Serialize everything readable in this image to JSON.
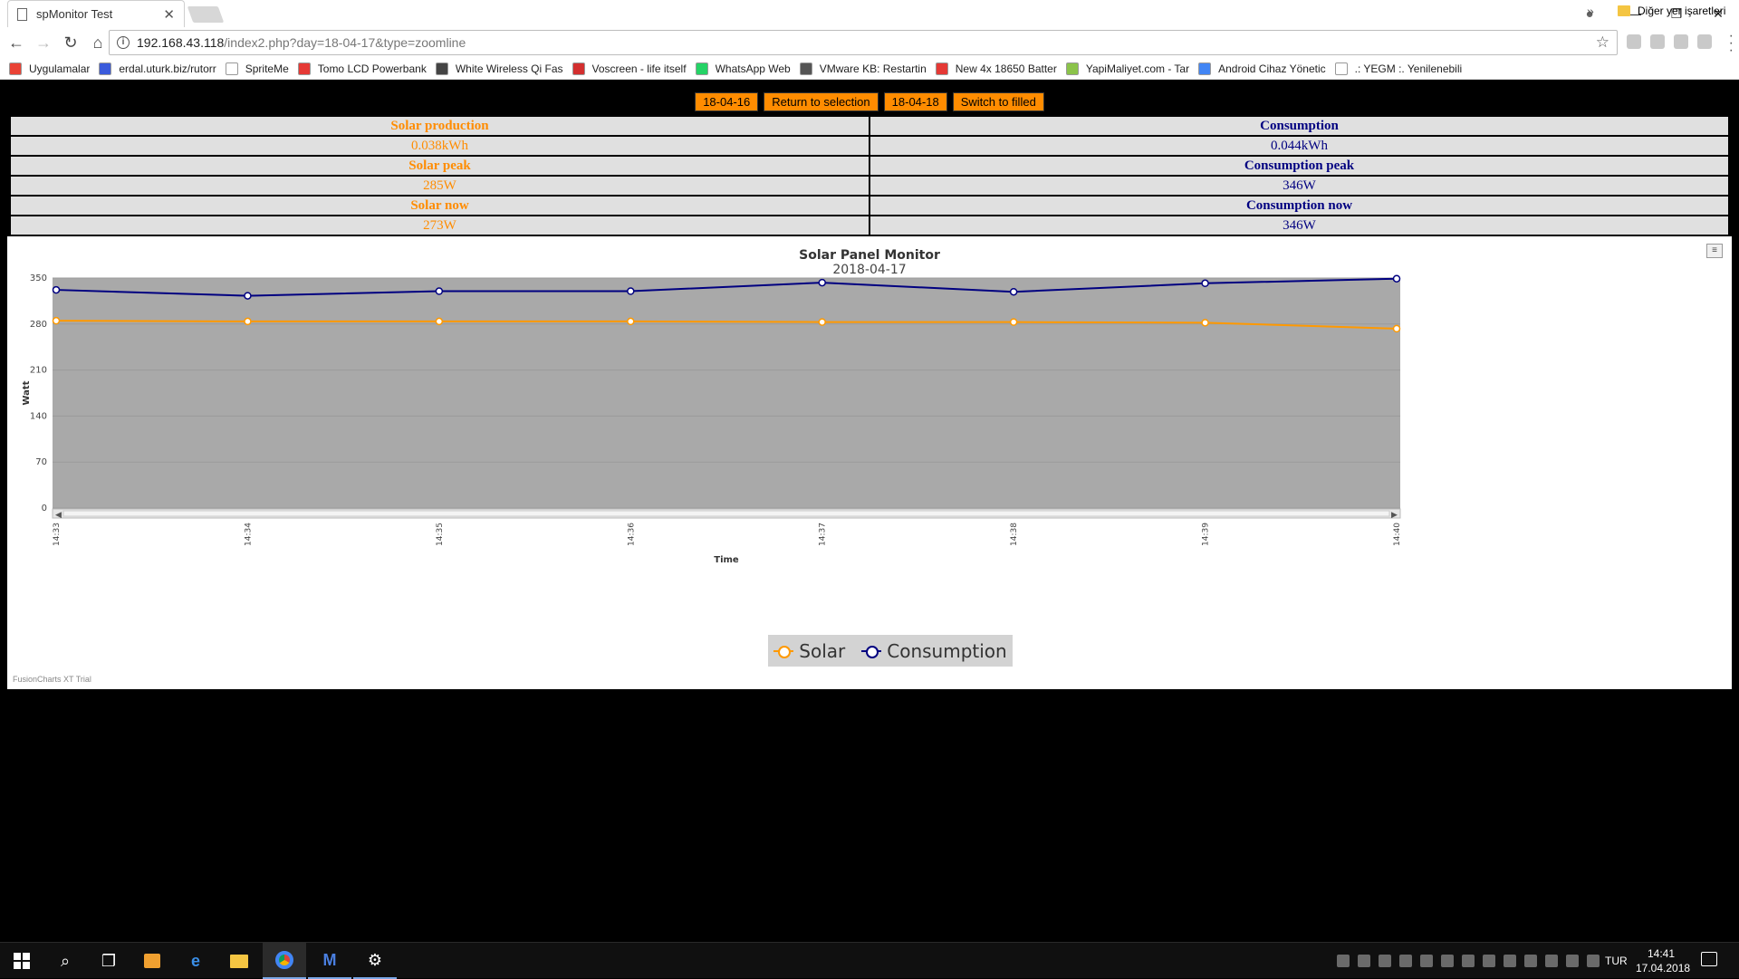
{
  "browser": {
    "tab_title": "spMonitor Test",
    "address_host": "192.168.43.118",
    "address_path": "/index2.php?day=18-04-17&type=zoomline",
    "bookmarks": [
      {
        "label": "Uygulamalar",
        "color": "#e94235"
      },
      {
        "label": "erdal.uturk.biz/rutorr",
        "color": "#3b5bdb"
      },
      {
        "label": "SpriteMe",
        "color": "#ffffff"
      },
      {
        "label": "Tomo LCD Powerbank",
        "color": "#e53935"
      },
      {
        "label": "White Wireless Qi Fas",
        "color": "#444444"
      },
      {
        "label": "Voscreen - life itself",
        "color": "#d32f2f"
      },
      {
        "label": "WhatsApp Web",
        "color": "#25d366"
      },
      {
        "label": "VMware KB: Restartin",
        "color": "#555555"
      },
      {
        "label": "New 4x 18650 Batter",
        "color": "#e53935"
      },
      {
        "label": "YapiMaliyet.com - Tar",
        "color": "#8bc34a"
      },
      {
        "label": "Android Cihaz Yönetic",
        "color": "#4285f4"
      },
      {
        "label": ".: YEGM :. Yenilenebili",
        "color": "#ffffff"
      }
    ],
    "other_bookmarks": "Diğer yer işaretleri"
  },
  "nav": {
    "prev_day": "18-04-16",
    "return": "Return to selection",
    "next_day": "18-04-18",
    "switch": "Switch to filled"
  },
  "stats": {
    "solar_production_label": "Solar production",
    "solar_production_value": "0.038kWh",
    "solar_peak_label": "Solar peak",
    "solar_peak_value": "285W",
    "solar_now_label": "Solar now",
    "solar_now_value": "273W",
    "consumption_label": "Consumption",
    "consumption_value": "0.044kWh",
    "consumption_peak_label": "Consumption peak",
    "consumption_peak_value": "346W",
    "consumption_now_label": "Consumption now",
    "consumption_now_value": "346W"
  },
  "chart_data": {
    "type": "line",
    "title": "Solar Panel Monitor",
    "subtitle": "2018-04-17",
    "xlabel": "Time",
    "ylabel": "Watt",
    "ylim": [
      0,
      350
    ],
    "yticks": [
      0,
      70,
      140,
      210,
      280,
      350
    ],
    "categories": [
      "14:33",
      "14:34",
      "14:35",
      "14:36",
      "14:37",
      "14:38",
      "14:39",
      "14:40"
    ],
    "series": [
      {
        "name": "Solar",
        "color": "#ff9900",
        "values": [
          285,
          284,
          284,
          284,
          283,
          283,
          282,
          273
        ]
      },
      {
        "name": "Consumption",
        "color": "#000080",
        "values": [
          332,
          323,
          330,
          330,
          343,
          329,
          342,
          349
        ]
      }
    ],
    "plot_background": "#a9a9a9",
    "legend_position": "bottom",
    "footer": "FusionCharts XT Trial"
  },
  "taskbar": {
    "language": "TUR",
    "time": "14:41",
    "date": "17.04.2018"
  }
}
